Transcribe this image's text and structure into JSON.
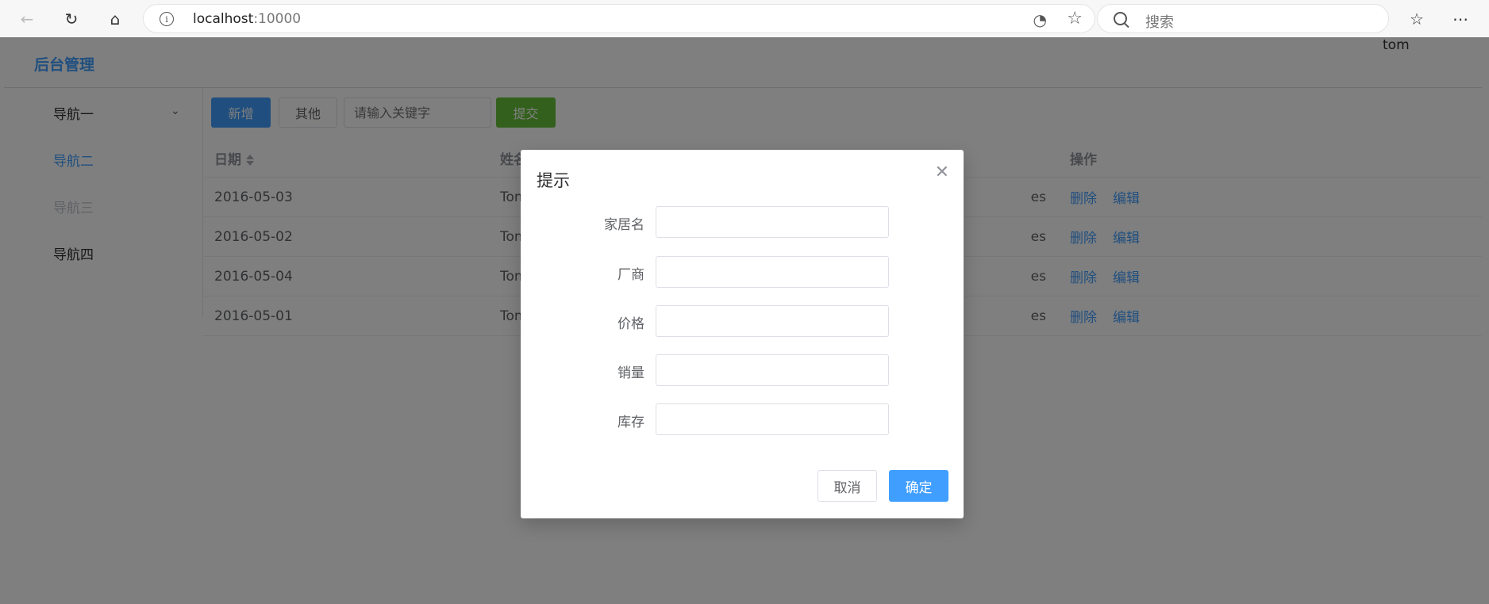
{
  "browser": {
    "url_host": "localhost",
    "url_port": ":10000",
    "search_placeholder": "搜索"
  },
  "app": {
    "brand": "后台管理",
    "user": "tom",
    "nav": [
      {
        "label": "导航一"
      },
      {
        "label": "导航二"
      },
      {
        "label": "导航三"
      },
      {
        "label": "导航四"
      }
    ]
  },
  "toolbar": {
    "add_label": "新增",
    "other_label": "其他",
    "keyword_placeholder": "请输入关键字",
    "submit_label": "提交"
  },
  "table": {
    "headers": {
      "date": "日期",
      "name": "姓名",
      "ops": "操作"
    },
    "rows": [
      {
        "date": "2016-05-03",
        "name": "Tom",
        "address_tail": "es"
      },
      {
        "date": "2016-05-02",
        "name": "Tom",
        "address_tail": "es"
      },
      {
        "date": "2016-05-04",
        "name": "Tom",
        "address_tail": "es"
      },
      {
        "date": "2016-05-01",
        "name": "Tom",
        "address_tail": "es"
      }
    ],
    "delete_label": "删除",
    "edit_label": "编辑"
  },
  "dialog": {
    "title": "提示",
    "fields": [
      {
        "label": "家居名",
        "value": ""
      },
      {
        "label": "厂商",
        "value": ""
      },
      {
        "label": "价格",
        "value": ""
      },
      {
        "label": "销量",
        "value": ""
      },
      {
        "label": "库存",
        "value": ""
      }
    ],
    "cancel_label": "取消",
    "ok_label": "确定"
  }
}
